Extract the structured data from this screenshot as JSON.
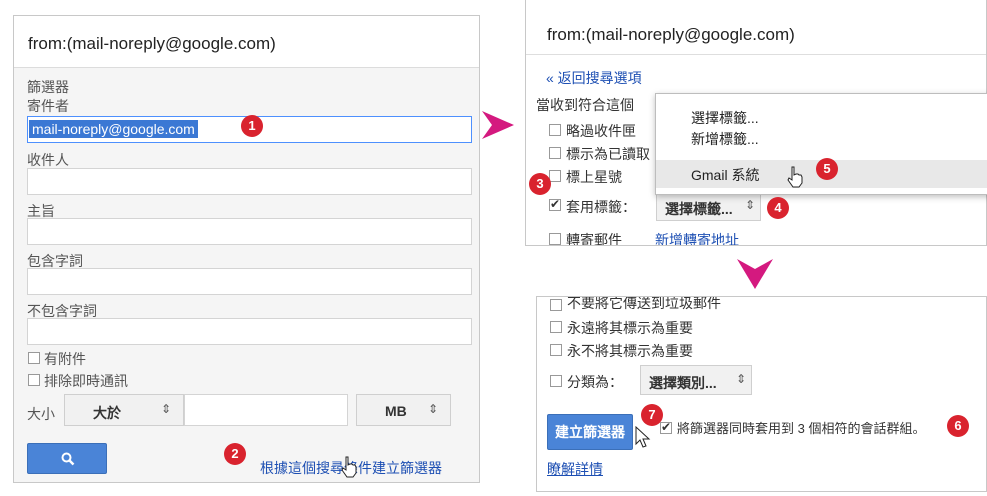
{
  "panelA": {
    "search_query": "from:(mail-noreply@google.com)",
    "filter_title": "篩選器",
    "from_label": "寄件者",
    "from_value": "mail-noreply@google.com",
    "to_label": "收件人",
    "subject_label": "主旨",
    "has_words_label": "包含字詞",
    "doesnt_have_label": "不包含字詞",
    "has_attachment_label": "有附件",
    "exclude_chats_label": "排除即時通訊",
    "size_label": "大小",
    "size_operator": "大於",
    "size_unit": "MB",
    "create_filter_link": "根據這個搜尋條件建立篩選器"
  },
  "panelB": {
    "search_query": "from:(mail-noreply@google.com)",
    "back_link": "« 返回搜尋選項",
    "when_arrives": "當收到符合這個",
    "skip_inbox": "略過收件匣",
    "mark_read": "標示為已讀取",
    "star_it": "標上星號",
    "apply_label": "套用標籤：",
    "choose_label_btn": "選擇標籤...",
    "forward_it": "轉寄郵件",
    "add_forward_link": "新增轉寄地址",
    "dropdown_items": [
      "選擇標籤...",
      "新增標籤...",
      "Gmail 系統"
    ]
  },
  "panelC": {
    "never_spam": "不要將它傳送到垃圾郵件",
    "always_important": "永遠將其標示為重要",
    "never_important": "永不將其標示為重要",
    "categorize": "分類為：",
    "choose_category_btn": "選擇類別...",
    "create_filter_btn": "建立篩選器",
    "also_apply": "將篩選器同時套用到 3 個相符的會話群組。",
    "learn_more": "瞭解詳情"
  },
  "badges": [
    "1",
    "2",
    "3",
    "4",
    "5",
    "6",
    "7"
  ],
  "colors": {
    "badge": "#d9232e",
    "accent_blue": "#4a84d7",
    "link": "#1d4fb3",
    "arrow": "#d4197f"
  }
}
